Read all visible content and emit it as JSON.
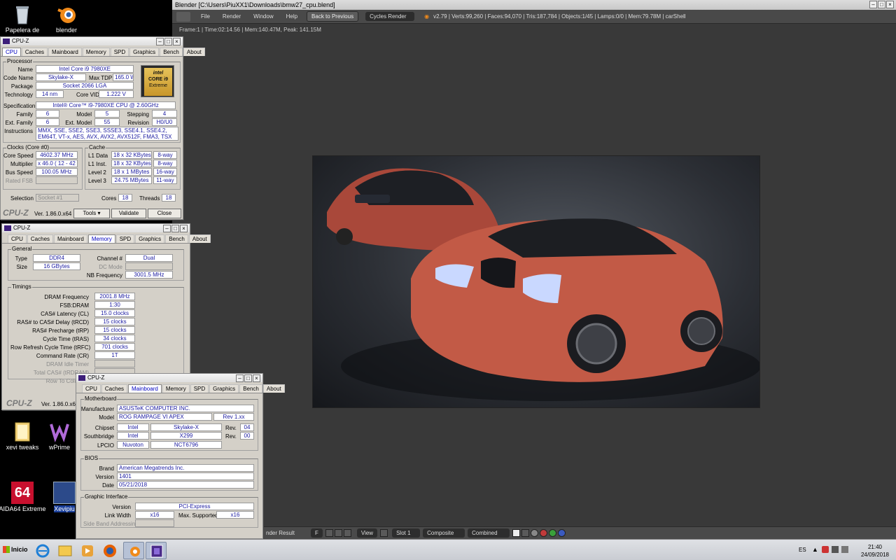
{
  "desktop": {
    "icons": [
      {
        "label": "Papelera de",
        "icon": "recycle-bin-icon"
      },
      {
        "label": "blender",
        "icon": "blender-icon"
      },
      {
        "label": "xevi tweaks",
        "icon": "folder-icon"
      },
      {
        "label": "wPrime",
        "icon": "wprime-icon"
      },
      {
        "label": "AIDA64 Extreme",
        "icon": "aida64-icon"
      },
      {
        "label": "Xevipiu",
        "icon": "shortcut-icon"
      }
    ],
    "aida_badge": "64"
  },
  "blender": {
    "title": "Blender [C:\\Users\\PiuXX1\\Downloads\\bmw27_cpu.blend]",
    "menu": [
      "File",
      "Render",
      "Window",
      "Help"
    ],
    "back_button": "Back to Previous",
    "engine": "Cycles Render",
    "stats": "v2.79 | Verts:99,260 | Faces:94,070 | Tris:187,784 | Objects:1/45 | Lamps:0/0 | Mem:79.78M | carShell",
    "frame_info": "Frame:1 | Time:02:14.56 | Mem:140.47M, Peak: 141.15M",
    "footer": {
      "result": "nder Result",
      "f": "F",
      "view": "View",
      "slot": "Slot 1",
      "pass": "Composite",
      "combined": "Combined"
    }
  },
  "cpuz1": {
    "title": "CPU-Z",
    "tabs": [
      "CPU",
      "Caches",
      "Mainboard",
      "Memory",
      "SPD",
      "Graphics",
      "Bench",
      "About"
    ],
    "processor_group": "Processor",
    "labels": {
      "name": "Name",
      "code": "Code Name",
      "tdp": "Max TDP",
      "package": "Package",
      "tech": "Technology",
      "vid": "Core VID",
      "spec": "Specification",
      "family": "Family",
      "model": "Model",
      "stepping": "Stepping",
      "extfam": "Ext. Family",
      "extmodel": "Ext. Model",
      "revision": "Revision",
      "instr": "Instructions"
    },
    "values": {
      "name": "Intel Core i9 7980XE",
      "code": "Skylake-X",
      "tdp": "165.0 W",
      "package": "Socket 2066 LGA",
      "tech": "14 nm",
      "vid": "1.222 V",
      "spec": "Intel® Core™ i9-7980XE CPU @ 2.60GHz",
      "family": "6",
      "model": "5",
      "stepping": "4",
      "extfam": "6",
      "extmodel": "55",
      "revision": "H0/U0",
      "instr1": "MMX, SSE, SSE2, SSE3, SSSE3, SSE4.1, SSE4.2, EM64T, VT-x,",
      "instr2": "AES, AVX, AVX2, AVX512F, FMA3, TSX"
    },
    "badge": {
      "brand": "intel",
      "line1": "CORE i9",
      "line2": "Extreme"
    },
    "clocks_group": "Clocks (Core #0)",
    "clocks": {
      "l_speed": "Core Speed",
      "speed": "4602.37 MHz",
      "l_mult": "Multiplier",
      "mult": "x 46.0 ( 12 - 42 )",
      "l_bus": "Bus Speed",
      "bus": "100.05 MHz",
      "l_fsb": "Rated FSB"
    },
    "cache_group": "Cache",
    "cache": [
      {
        "l": "L1 Data",
        "v": "18 x 32 KBytes",
        "w": "8-way"
      },
      {
        "l": "L1 Inst.",
        "v": "18 x 32 KBytes",
        "w": "8-way"
      },
      {
        "l": "Level 2",
        "v": "18 x 1 MBytes",
        "w": "16-way"
      },
      {
        "l": "Level 3",
        "v": "24.75 MBytes",
        "w": "11-way"
      }
    ],
    "selection": {
      "label": "Selection",
      "value": "Socket #1",
      "cores_label": "Cores",
      "cores": "18",
      "threads_label": "Threads",
      "threads": "18"
    },
    "footer": {
      "brand": "CPU-Z",
      "version": "Ver. 1.86.0.x64",
      "tools": "Tools",
      "validate": "Validate",
      "close": "Close"
    }
  },
  "cpuz2": {
    "title": "CPU-Z",
    "general_group": "General",
    "type_label": "Type",
    "type": "DDR4",
    "size_label": "Size",
    "size": "16 GBytes",
    "channel_label": "Channel #",
    "channel": "Dual",
    "dc_label": "DC Mode",
    "nb_label": "NB Frequency",
    "nb": "3001.5 MHz",
    "timings_group": "Timings",
    "timings": [
      {
        "l": "DRAM Frequency",
        "v": "2001.8 MHz"
      },
      {
        "l": "FSB:DRAM",
        "v": "1:30"
      },
      {
        "l": "CAS# Latency (CL)",
        "v": "15.0 clocks"
      },
      {
        "l": "RAS# to CAS# Delay (tRCD)",
        "v": "15 clocks"
      },
      {
        "l": "RAS# Precharge (tRP)",
        "v": "15 clocks"
      },
      {
        "l": "Cycle Time (tRAS)",
        "v": "34 clocks"
      },
      {
        "l": "Row Refresh Cycle Time (tRFC)",
        "v": "701 clocks"
      },
      {
        "l": "Command Rate (CR)",
        "v": "1T"
      }
    ],
    "dis_timings": [
      "DRAM Idle Timer",
      "Total CAS# (tRDRAM)",
      "Row To Column ("
    ],
    "footer_brand": "CPU-Z",
    "footer_version": "Ver. 1.86.0.x64"
  },
  "cpuz3": {
    "title": "CPU-Z",
    "mb_group": "Motherboard",
    "mb": {
      "l_man": "Manufacturer",
      "man": "ASUSTeK COMPUTER INC.",
      "l_model": "Model",
      "model": "ROG RAMPAGE VI APEX",
      "rev": "Rev 1.xx",
      "l_chip": "Chipset",
      "chip_v": "Intel",
      "chip_m": "Skylake-X",
      "l_rev": "Rev.",
      "chip_rev": "04",
      "l_south": "Southbridge",
      "south_v": "Intel",
      "south_m": "X299",
      "south_rev": "00",
      "l_lpcio": "LPCIO",
      "lpc_v": "Nuvoton",
      "lpc_m": "NCT6796"
    },
    "bios_group": "BIOS",
    "bios": {
      "l_brand": "Brand",
      "brand": "American Megatrends Inc.",
      "l_ver": "Version",
      "ver": "1401",
      "l_date": "Date",
      "date": "05/21/2018"
    },
    "gi_group": "Graphic Interface",
    "gi": {
      "l_ver": "Version",
      "ver": "PCI-Express",
      "l_lw": "Link Width",
      "lw": "x16",
      "l_max": "Max. Supported",
      "max": "x16",
      "l_sba": "Side Band Addressing"
    }
  },
  "taskbar": {
    "start": "Inicio",
    "lang": "ES",
    "time": "21:40",
    "date": "24/09/2018"
  }
}
